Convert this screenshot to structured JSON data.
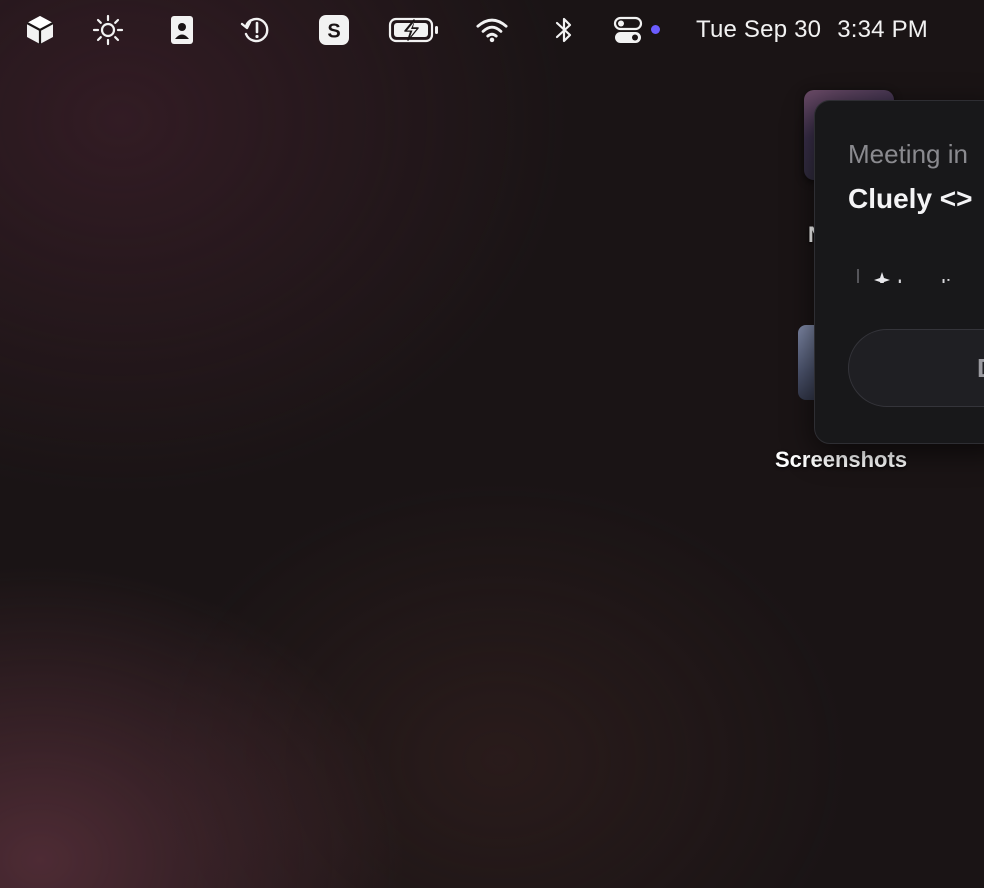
{
  "menubar": {
    "icons": [
      {
        "name": "cube-app-icon"
      },
      {
        "name": "brightness-icon"
      },
      {
        "name": "contact-card-icon"
      },
      {
        "name": "time-machine-icon"
      },
      {
        "name": "s-app-icon",
        "glyph": "S"
      },
      {
        "name": "battery-charging-icon"
      },
      {
        "name": "wifi-icon"
      },
      {
        "name": "bluetooth-icon"
      },
      {
        "name": "control-center-icon"
      }
    ],
    "accent_dot_color": "#6b5cff",
    "date": "Tue Sep 30",
    "time": "3:34 PM"
  },
  "desktop": {
    "items": [
      {
        "label": "N"
      },
      {
        "label": "Screenshots"
      }
    ]
  },
  "meeting_popup": {
    "subtitle": "Meeting in",
    "title": "Cluely <>",
    "status": "Loading",
    "button_label": "D"
  }
}
